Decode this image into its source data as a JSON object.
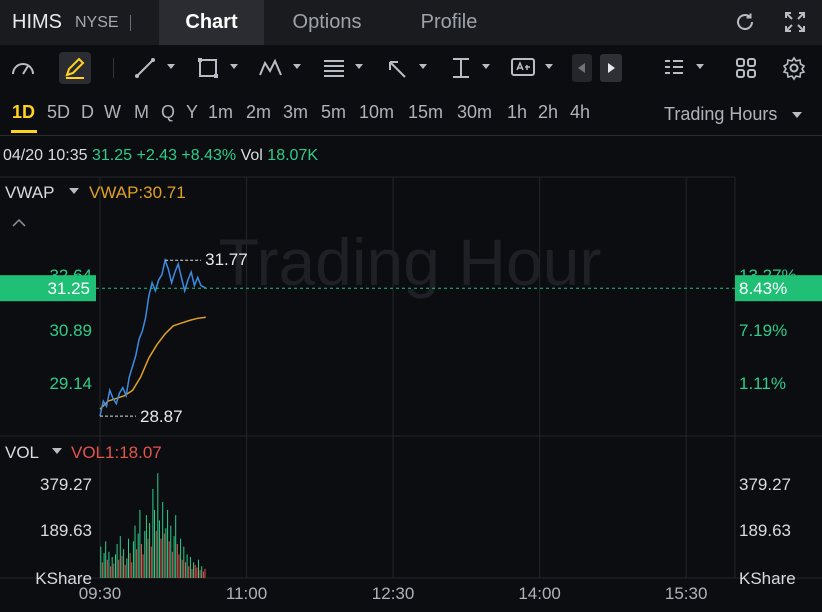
{
  "header": {
    "symbol": "HIMS",
    "exchange": "NYSE",
    "tabs": [
      {
        "label": "Chart",
        "active": true
      },
      {
        "label": "Options",
        "active": false
      },
      {
        "label": "Profile",
        "active": false
      }
    ],
    "refresh_icon": "refresh-icon",
    "fullscreen_icon": "expand-icon"
  },
  "toolbar": {
    "icons": [
      "gauge-icon",
      "pen-icon",
      "line-tool-icon",
      "rectangle-tool-icon",
      "wave-pattern-icon",
      "text-fib-icon",
      "arrow-tool-icon",
      "measure-tool-icon",
      "text-tool-icon",
      "prev-icon",
      "next-icon",
      "layout-list-icon",
      "grid-icon",
      "settings-icon"
    ]
  },
  "intervals": {
    "items": [
      "1D",
      "5D",
      "D",
      "W",
      "M",
      "Q",
      "Y",
      "1m",
      "2m",
      "3m",
      "5m",
      "10m",
      "15m",
      "30m",
      "1h",
      "2h",
      "4h"
    ],
    "active": "1D",
    "session": "Trading Hours"
  },
  "quote": {
    "time": "04/20 10:35",
    "price": "31.25",
    "change": "+2.43",
    "change_pct": "+8.43%",
    "vol_label": "Vol",
    "vol": "18.07K"
  },
  "price_panel": {
    "indicator": "VWAP",
    "indicator_value": "VWAP:30.71",
    "watermark": "Trading Hour",
    "left_ticks": [
      "32.64",
      "29.14"
    ],
    "right_ticks": [
      "13.27%",
      "1.11%"
    ],
    "current_price": "31.25",
    "current_pct": "8.43%",
    "hidden_left": "30.89",
    "hidden_right": "7.19%",
    "high_label": "31.77",
    "low_label": "28.87"
  },
  "volume_panel": {
    "indicator": "VOL",
    "indicator_value": "VOL1:18.07",
    "ticks": [
      "379.27",
      "189.63"
    ],
    "unit": "KShare"
  },
  "time_axis": [
    "09:30",
    "11:00",
    "12:30",
    "14:00",
    "15:30"
  ],
  "colors": {
    "up": "#2ecc8a",
    "down": "#e5534b",
    "price_line": "#3d8be0",
    "vwap_line": "#e0a023",
    "highlight": "#ffd21f",
    "price_tag": "#1fbf75"
  },
  "chart_data": {
    "type": "line",
    "title": "",
    "xlabel": "",
    "ylabel": "",
    "x_range": [
      "09:30",
      "16:00"
    ],
    "ylim": [
      28.5,
      33.3
    ],
    "series": [
      {
        "name": "",
        "x": [
          "09:30",
          "09:32",
          "09:34",
          "09:36",
          "09:38",
          "09:40",
          "09:42",
          "09:44",
          "09:46",
          "09:48",
          "09:50",
          "09:52",
          "09:54",
          "09:56",
          "09:58",
          "10:00",
          "10:02",
          "10:04",
          "10:06",
          "10:08",
          "10:10",
          "10:12",
          "10:14",
          "10:16",
          "10:18",
          "10:20",
          "10:22",
          "10:24",
          "10:26",
          "10:28",
          "10:30",
          "10:32",
          "10:35"
        ],
        "values": [
          28.87,
          29.15,
          29.05,
          29.35,
          29.2,
          29.1,
          29.3,
          29.4,
          29.25,
          29.6,
          29.8,
          30.0,
          30.3,
          30.45,
          30.7,
          31.1,
          31.35,
          31.2,
          31.4,
          31.5,
          31.77,
          31.6,
          31.35,
          31.55,
          31.7,
          31.45,
          31.2,
          31.4,
          31.55,
          31.3,
          31.45,
          31.3,
          31.25
        ]
      },
      {
        "name": "VWAP",
        "x": [
          "09:30",
          "09:35",
          "09:40",
          "09:45",
          "09:50",
          "09:55",
          "10:00",
          "10:05",
          "10:10",
          "10:15",
          "10:20",
          "10:25",
          "10:30",
          "10:35"
        ],
        "values": [
          29.0,
          29.15,
          29.2,
          29.25,
          29.35,
          29.6,
          29.95,
          30.2,
          30.4,
          30.55,
          30.6,
          30.65,
          30.69,
          30.71
        ]
      }
    ],
    "volume": {
      "ylim": [
        0,
        420
      ],
      "values": [
        120,
        60,
        95,
        140,
        70,
        100,
        45,
        80,
        55,
        90,
        130,
        70,
        160,
        85,
        110,
        50,
        75,
        150,
        95,
        60,
        140,
        200,
        110,
        170,
        260,
        130,
        90,
        180,
        240,
        150,
        210,
        120,
        340,
        260,
        180,
        400,
        220,
        150,
        290,
        170,
        190,
        260,
        140,
        200,
        100,
        160,
        240,
        130,
        90,
        150,
        70,
        120,
        60,
        90,
        45,
        80,
        35,
        60,
        50,
        40,
        70,
        30,
        45,
        25,
        35
      ],
      "up": [
        true,
        false,
        true,
        true,
        false,
        true,
        false,
        true,
        false,
        true,
        true,
        false,
        true,
        false,
        true,
        false,
        true,
        true,
        false,
        false,
        true,
        true,
        false,
        true,
        true,
        false,
        false,
        true,
        true,
        false,
        true,
        false,
        true,
        true,
        false,
        true,
        true,
        false,
        true,
        false,
        true,
        true,
        false,
        true,
        false,
        true,
        true,
        false,
        false,
        true,
        false,
        true,
        false,
        true,
        false,
        true,
        false,
        true,
        false,
        false,
        true,
        false,
        true,
        false,
        false
      ]
    }
  }
}
